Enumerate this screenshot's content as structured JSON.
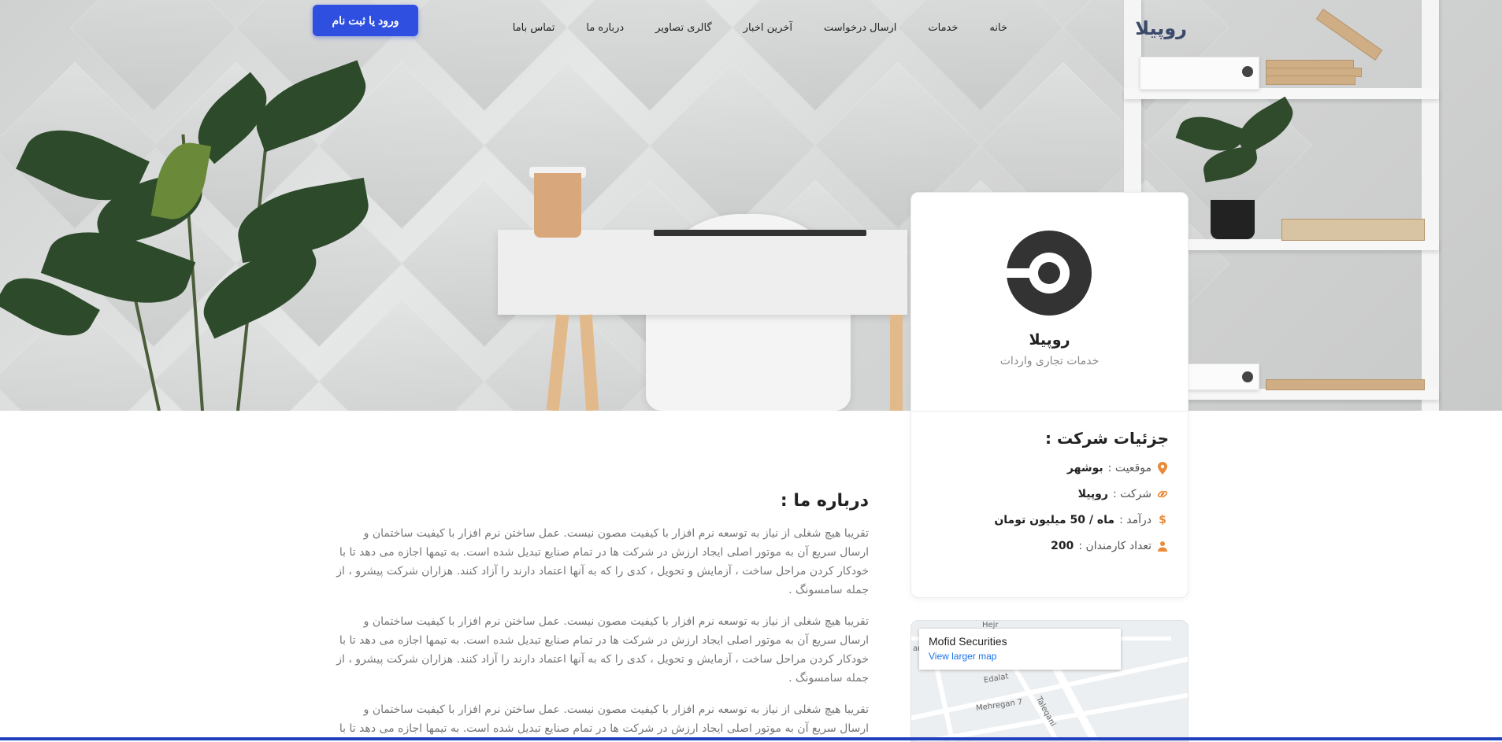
{
  "nav": {
    "brand": "روپیلا",
    "links": [
      "خانه",
      "خدمات",
      "ارسال درخواست",
      "آخرین اخبار",
      "گالری تصاویر",
      "درباره ما",
      "تماس باما"
    ],
    "login_label": "ورود یا ثبت نام"
  },
  "profile": {
    "name": "روپیلا",
    "subtitle": "خدمات تجاری واردات",
    "details_title": "جزئیات شرکت :",
    "details": [
      {
        "icon": "map-pin-icon",
        "label": "موقعیت :",
        "value": "بوشهر"
      },
      {
        "icon": "link-icon",
        "label": "شرکت :",
        "value": "روپیلا"
      },
      {
        "icon": "dollar-icon",
        "label": "درآمد :",
        "value": "ماه / 50 میلیون تومان"
      },
      {
        "icon": "user-icon",
        "label": "تعداد کارمندان :",
        "value": "200"
      }
    ]
  },
  "map": {
    "place": "Mofid Securities",
    "link": "View larger map",
    "streets": [
      "Edalat",
      "Mehregan 7",
      "Taleqani",
      "Hejr",
      "ar"
    ]
  },
  "about": {
    "title": "درباره ما :",
    "paragraphs": [
      "تقریبا هیچ شغلی از نیاز به توسعه نرم افزار با کیفیت مصون نیست. عمل ساختن نرم افزار با کیفیت ساختمان و ارسال سریع آن به موتور اصلی ایجاد ارزش در شرکت ها در تمام صنایع تبدیل شده است. به تیمها اجازه می دهد تا با خودکار کردن مراحل ساخت ، آزمایش و تحویل ، کدی را که به آنها اعتماد دارند را آزاد کنند. هزاران شرکت پیشرو ، از جمله سامسونگ .",
      "تقریبا هیچ شغلی از نیاز به توسعه نرم افزار با کیفیت مصون نیست. عمل ساختن نرم افزار با کیفیت ساختمان و ارسال سریع آن به موتور اصلی ایجاد ارزش در شرکت ها در تمام صنایع تبدیل شده است. به تیمها اجازه می دهد تا با خودکار کردن مراحل ساخت ، آزمایش و تحویل ، کدی را که به آنها اعتماد دارند را آزاد کنند. هزاران شرکت پیشرو ، از جمله سامسونگ .",
      "تقریبا هیچ شغلی از نیاز به توسعه نرم افزار با کیفیت مصون نیست. عمل ساختن نرم افزار با کیفیت ساختمان و ارسال سریع آن به موتور اصلی ایجاد ارزش در شرکت ها در تمام صنایع تبدیل شده است. به تیمها اجازه می دهد تا با خودکار کردن مراحل ساخت"
    ]
  },
  "colors": {
    "accent": "#2e4fe0",
    "icon": "#e98a3a",
    "text_muted": "#777777"
  }
}
